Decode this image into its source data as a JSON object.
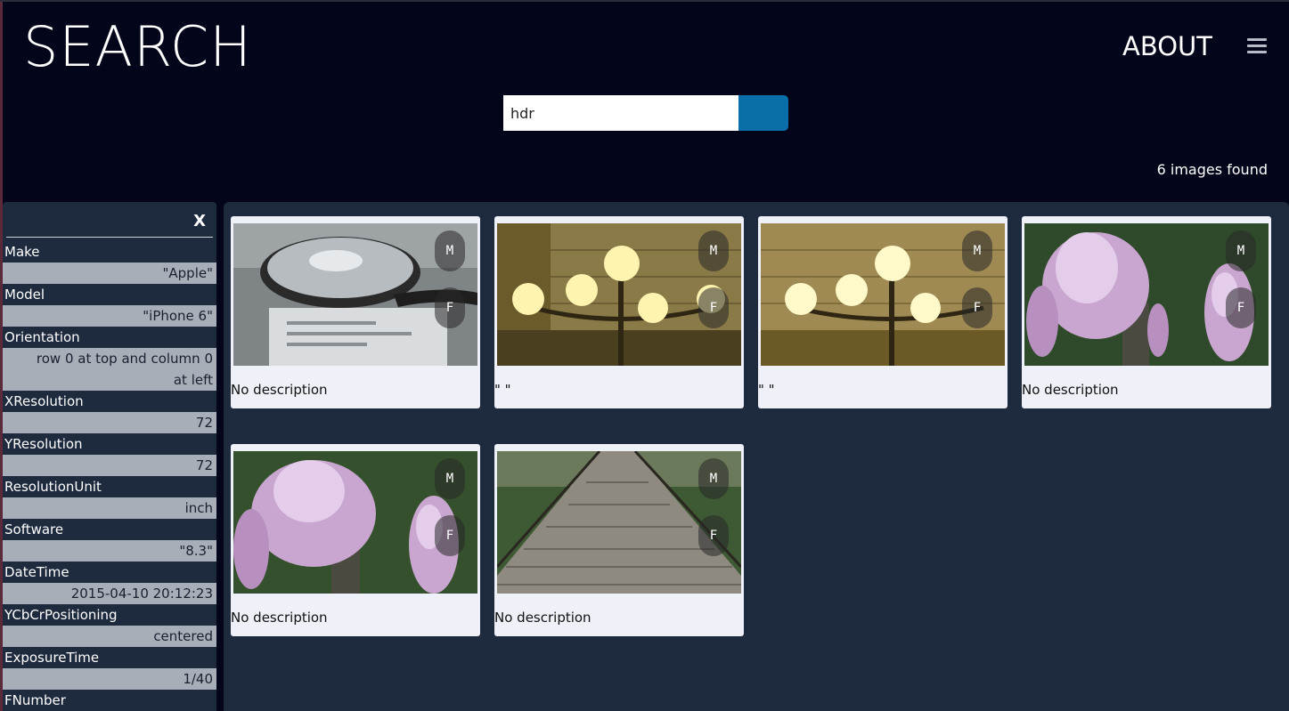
{
  "header": {
    "title": "SEARCH",
    "about_label": "ABOUT",
    "menu_icon": "hamburger-menu-icon"
  },
  "search": {
    "value": "hdr",
    "button_icon": "search-icon",
    "accent": "#0a6ea8"
  },
  "results": {
    "count_text": "6 images found"
  },
  "exif": {
    "close_label": "X",
    "fields": [
      {
        "key": "Make",
        "value": "\"Apple\""
      },
      {
        "key": "Model",
        "value": "\"iPhone 6\""
      },
      {
        "key": "Orientation",
        "value": "row 0 at top and column 0 at left"
      },
      {
        "key": "XResolution",
        "value": "72"
      },
      {
        "key": "YResolution",
        "value": "72"
      },
      {
        "key": "ResolutionUnit",
        "value": "inch"
      },
      {
        "key": "Software",
        "value": "\"8.3\""
      },
      {
        "key": "DateTime",
        "value": "2015-04-10 20:12:23"
      },
      {
        "key": "YCbCrPositioning",
        "value": "centered"
      },
      {
        "key": "ExposureTime",
        "value": "1/40"
      },
      {
        "key": "FNumber",
        "value": ""
      }
    ]
  },
  "cards": [
    {
      "image": "tape-roll-photo",
      "description": "No description",
      "m_label": "M",
      "f_label": "F"
    },
    {
      "image": "street-lamp-photo",
      "description": "\" \"",
      "m_label": "M",
      "f_label": "F"
    },
    {
      "image": "street-lamp-photo",
      "description": "\" \"",
      "m_label": "M",
      "f_label": "F"
    },
    {
      "image": "wisteria-photo",
      "description": "No description",
      "m_label": "M",
      "f_label": "F"
    },
    {
      "image": "wisteria-photo",
      "description": "No description",
      "m_label": "M",
      "f_label": "F"
    },
    {
      "image": "boardwalk-photo",
      "description": "No description",
      "m_label": "M",
      "f_label": "F"
    }
  ]
}
